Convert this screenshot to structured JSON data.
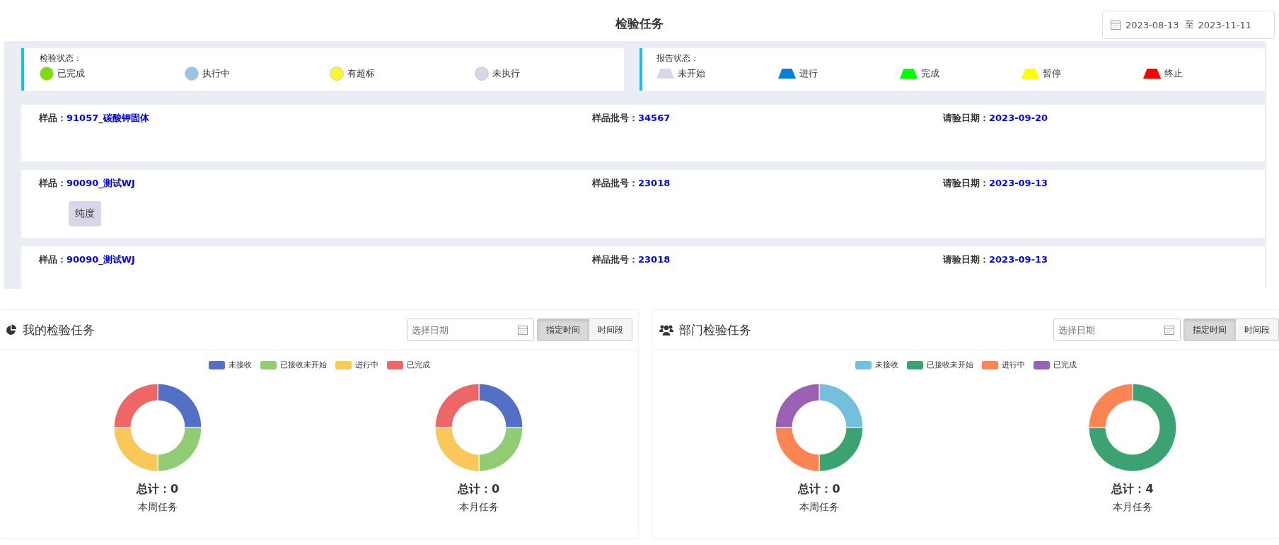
{
  "page_title": "检验任务",
  "date_range": {
    "start": "2023-08-13",
    "separator": "至",
    "end": "2023-11-11"
  },
  "legends": [
    {
      "title": "检验状态：",
      "items": [
        {
          "label": "已完成",
          "color": "#7ddc00",
          "kind": "circle"
        },
        {
          "label": "执行中",
          "color": "#9cc3e6",
          "kind": "circle"
        },
        {
          "label": "有超标",
          "color": "#f9f62e",
          "kind": "circle"
        },
        {
          "label": "未执行",
          "color": "#d8d6e8",
          "kind": "circle"
        }
      ]
    },
    {
      "title": "报告状态：",
      "items": [
        {
          "label": "未开始",
          "color": "#d8d6e8",
          "kind": "trapezoid"
        },
        {
          "label": "进行",
          "color": "#0a7fd6",
          "kind": "trapezoid"
        },
        {
          "label": "完成",
          "color": "#00ff00",
          "kind": "trapezoid"
        },
        {
          "label": "暂停",
          "color": "#ffff00",
          "kind": "trapezoid"
        },
        {
          "label": "终止",
          "color": "#ff0000",
          "kind": "trapezoid"
        }
      ]
    }
  ],
  "samples": [
    {
      "fields": [
        {
          "label": "样品：",
          "value": "91057_碳酸钾固体"
        },
        {
          "label": "样品批号：",
          "value": "34567"
        },
        {
          "label": "请验日期：",
          "value": "2023-09-20"
        }
      ]
    },
    {
      "fields": [
        {
          "label": "样品：",
          "value": "90090_测试WJ"
        },
        {
          "label": "样品批号：",
          "value": "23018"
        },
        {
          "label": "请验日期：",
          "value": "2023-09-13"
        }
      ],
      "tags": [
        "纯度"
      ]
    },
    {
      "fields": [
        {
          "label": "样品：",
          "value": "90090_测试WJ"
        },
        {
          "label": "样品批号：",
          "value": "23018"
        },
        {
          "label": "请验日期：",
          "value": "2023-09-13"
        }
      ]
    }
  ],
  "panels": [
    {
      "kind": "personal",
      "title": "我的检验任务",
      "date_field": {
        "placeholder": "选择日期"
      },
      "buttons": [
        {
          "label": "指定时间",
          "selected": true
        },
        {
          "label": "时间段",
          "selected": false
        }
      ],
      "legend": [
        {
          "label": "未接收",
          "color": "#5470c6"
        },
        {
          "label": "已接收未开始",
          "color": "#91cc75"
        },
        {
          "label": "进行中",
          "color": "#fac858"
        },
        {
          "label": "已完成",
          "color": "#ee6666"
        }
      ],
      "charts": [
        {
          "total": "总计：0",
          "caption": "本周任务",
          "chart_data": {
            "type": "donut",
            "values": [
              25,
              25,
              25,
              25
            ]
          }
        },
        {
          "total": "总计：0",
          "caption": "本月任务",
          "chart_data": {
            "type": "donut",
            "values": [
              25,
              25,
              25,
              25
            ]
          }
        }
      ]
    },
    {
      "kind": "department",
      "title": "部门检验任务",
      "date_field": {
        "placeholder": "选择日期"
      },
      "buttons": [
        {
          "label": "指定时间",
          "selected": true
        },
        {
          "label": "时间段",
          "selected": false
        }
      ],
      "legend": [
        {
          "label": "未接收",
          "color": "#73c0de"
        },
        {
          "label": "已接收未开始",
          "color": "#3ba272"
        },
        {
          "label": "进行中",
          "color": "#fc8452"
        },
        {
          "label": "已完成",
          "color": "#9a60b4"
        }
      ],
      "charts": [
        {
          "total": "总计：0",
          "caption": "本周任务",
          "chart_data": {
            "type": "donut",
            "values": [
              25,
              25,
              25,
              25
            ]
          }
        },
        {
          "total": "总计：4",
          "caption": "本月任务",
          "chart_data": {
            "type": "donut",
            "values": [
              0,
              75,
              25,
              0
            ]
          }
        }
      ]
    }
  ]
}
